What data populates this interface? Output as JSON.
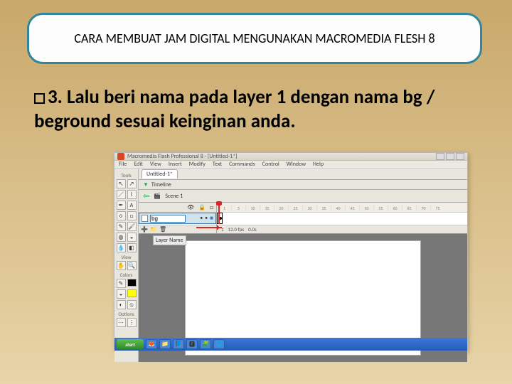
{
  "slide": {
    "title": "CARA MEMBUAT JAM DIGITAL MENGUNAKAN MACROMEDIA FLESH 8",
    "step_number": "3.",
    "step_text": "Lalu beri nama pada layer 1 dengan nama bg / beground sesuai keinginan anda."
  },
  "flash": {
    "app_title": "Macromedia Flash Professional 8 - [Untitled-1*]",
    "menus": [
      "File",
      "Edit",
      "View",
      "Insert",
      "Modify",
      "Text",
      "Commands",
      "Control",
      "Window",
      "Help"
    ],
    "doc_tab": "Untitled-1*",
    "scene": "Scene 1",
    "timeline_label": "Timeline",
    "layer_name_value": "bg",
    "annotation": "Layer Name",
    "ruler_ticks": [
      "1",
      "5",
      "10",
      "15",
      "20",
      "25",
      "30",
      "35",
      "40",
      "45",
      "50",
      "55",
      "60",
      "65",
      "70",
      "75"
    ],
    "footer": {
      "frame": "1",
      "fps": "12.0 fps",
      "time": "0.0s"
    },
    "toolbox": {
      "section_tools": "Tools",
      "section_view": "View",
      "section_colors": "Colors",
      "section_options": "Options"
    },
    "colors": {
      "stroke": "#000000",
      "fill": "#ffff00"
    }
  },
  "taskbar": {
    "start": "start",
    "items": [
      "🦊",
      "📁",
      "📘",
      "🅵",
      "🧩",
      "🌐"
    ]
  }
}
